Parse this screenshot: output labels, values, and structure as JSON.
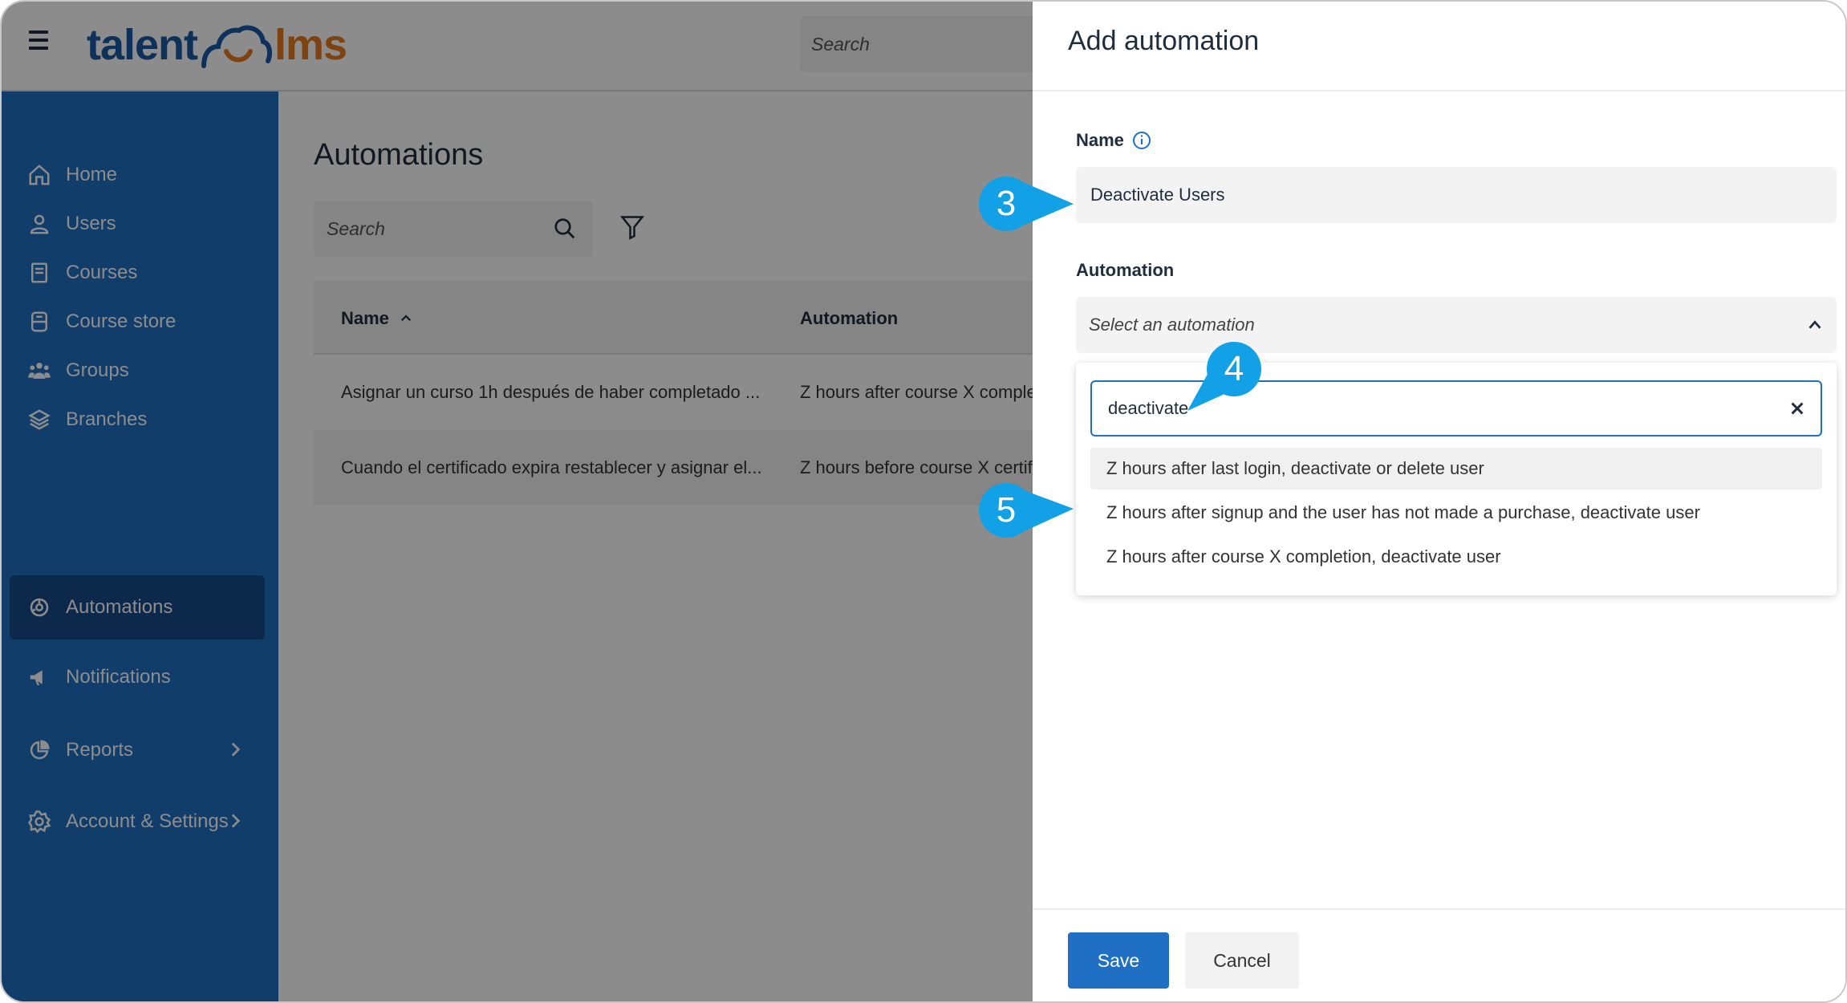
{
  "header": {
    "logo_left": "talent",
    "logo_right": "lms",
    "search_placeholder": "Search"
  },
  "sidebar": {
    "items": [
      {
        "label": "Home",
        "icon": "home-icon"
      },
      {
        "label": "Users",
        "icon": "user-icon"
      },
      {
        "label": "Courses",
        "icon": "book-icon"
      },
      {
        "label": "Course store",
        "icon": "store-icon"
      },
      {
        "label": "Groups",
        "icon": "groups-icon"
      },
      {
        "label": "Branches",
        "icon": "layers-icon"
      },
      {
        "label": "Automations",
        "icon": "automation-icon",
        "active": true
      },
      {
        "label": "Notifications",
        "icon": "megaphone-icon"
      },
      {
        "label": "Reports",
        "icon": "pie-chart-icon",
        "has_submenu": true
      },
      {
        "label": "Account & Settings",
        "icon": "gear-icon",
        "has_submenu": true
      }
    ]
  },
  "main": {
    "title": "Automations",
    "search_placeholder": "Search",
    "table": {
      "columns": [
        "Name",
        "Automation"
      ],
      "rows": [
        {
          "name": "Asignar un curso 1h después de haber completado ...",
          "automation": "Z hours after course X completion"
        },
        {
          "name": "Cuando el certificado expira restablecer y asignar el...",
          "automation": "Z hours before course X certificat"
        }
      ]
    }
  },
  "drawer": {
    "title": "Add automation",
    "name_label": "Name",
    "name_value": "Deactivate Users",
    "automation_label": "Automation",
    "select_placeholder": "Select an automation",
    "dropdown_search_value": "deactivate",
    "options": [
      "Z hours after last login, deactivate or delete user",
      "Z hours after signup and the user has not made a purchase, deactivate user",
      "Z hours after course X completion, deactivate user"
    ],
    "save_label": "Save",
    "cancel_label": "Cancel"
  },
  "callouts": [
    "3",
    "4",
    "5"
  ],
  "colors": {
    "sidebar": "#1f6fc4",
    "sidebar_active": "#174a87",
    "primary_button": "#1f6fc4",
    "callout": "#12a0e6",
    "logo_blue": "#1b5aa6",
    "logo_orange": "#e8781f"
  }
}
